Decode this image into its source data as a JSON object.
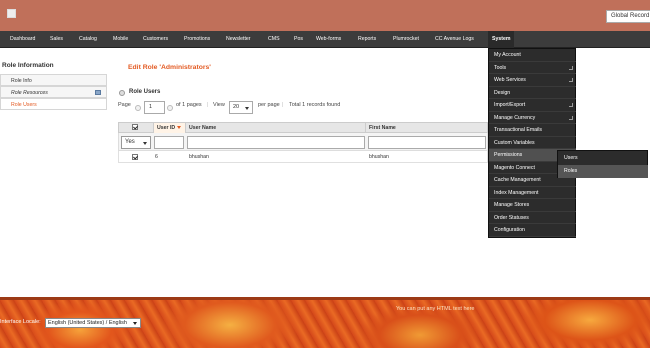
{
  "header": {
    "logo_icon": "broken-image-icon",
    "global_search_placeholder": "Global Record Search"
  },
  "nav": {
    "items": [
      "Dashboard",
      "Sales",
      "Catalog",
      "Mobile",
      "Customers",
      "Promotions",
      "Newsletter",
      "CMS",
      "Pos",
      "Web-forms",
      "Reports",
      "Plumrocket",
      "CC Avenue Logs",
      "System"
    ],
    "active": "System"
  },
  "system_menu": {
    "items": [
      "My Account",
      "Tools",
      "Web Services",
      "Design",
      "Import/Export",
      "Manage Currency",
      "Transactional Emails",
      "Custom Variables",
      "Permissions",
      "Magento Connect",
      "Cache Management",
      "Index Management",
      "Manage Stores",
      "Order Statuses",
      "Configuration"
    ],
    "highlighted": "Permissions",
    "permissions_submenu": [
      "Users",
      "Roles"
    ],
    "submenu_highlighted": "Roles"
  },
  "sidebar": {
    "title": "Role Information",
    "tabs": [
      "Role Info",
      "Role Resources",
      "Role Users"
    ],
    "active_tab": "Role Users"
  },
  "main": {
    "title": "Edit Role 'Administrators'",
    "section_title": "Role Users",
    "pager": {
      "page_label": "Page",
      "page_value": "1",
      "of_pages": "of 1 pages",
      "view_label": "View",
      "per_page_value": "20",
      "per_page_label": "per page",
      "records_found": "Total 1 records found"
    },
    "grid": {
      "columns": [
        "User ID",
        "User Name",
        "First Name"
      ],
      "filter_select": "Yes",
      "rows": [
        {
          "checked": true,
          "user_id": "6",
          "user_name": "bhushan",
          "first_name": "bhushan"
        }
      ]
    }
  },
  "footer": {
    "locale_label": "Interface Locale:",
    "locale_value": "English (United States) / English",
    "html_text": "You can put any HTML text here"
  },
  "colors": {
    "header_bg": "#c0705a",
    "nav_bg": "#3c3c3c",
    "accent": "#e35a22"
  }
}
